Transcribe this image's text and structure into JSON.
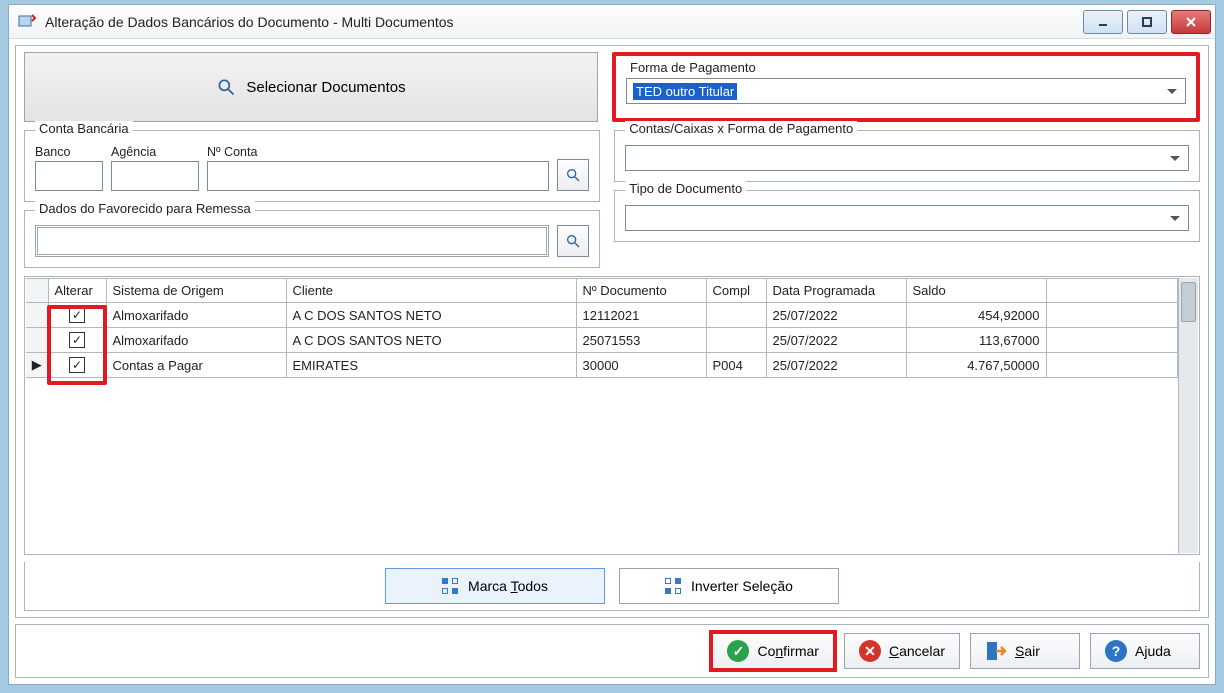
{
  "window": {
    "title": "Alteração de Dados Bancários do Documento - Multi Documentos"
  },
  "buttons": {
    "select_docs": "Selecionar Documentos",
    "marca_todos_pre": "Marca ",
    "marca_todos_key": "T",
    "marca_todos_post": "odos",
    "inverter": "Inverter Seleção",
    "confirmar_pre": "Co",
    "confirmar_key": "n",
    "confirmar_post": "firmar",
    "cancelar_key": "C",
    "cancelar_post": "ancelar",
    "sair_key": "S",
    "sair_post": "air",
    "ajuda": "Ajuda"
  },
  "groups": {
    "forma_pagamento": "Forma de Pagamento",
    "conta_bancaria": "Conta Bancária",
    "banco": "Banco",
    "agencia": "Agência",
    "n_conta": "Nº Conta",
    "favorecido": "Dados do Favorecido para Remessa",
    "contas_caixas": "Contas/Caixas x Forma de Pagamento",
    "tipo_documento": "Tipo de Documento"
  },
  "forma_pagamento_value": "TED outro Titular",
  "contas_caixas_value": "",
  "tipo_documento_value": "",
  "table": {
    "cols": {
      "alterar": "Alterar",
      "sistema": "Sistema de Origem",
      "cliente": "Cliente",
      "ndoc": "Nº Documento",
      "compl": "Compl",
      "data": "Data Programada",
      "saldo": "Saldo"
    },
    "rows": [
      {
        "alterar": true,
        "sistema": "Almoxarifado",
        "cliente": "A C DOS SANTOS NETO",
        "ndoc": "12112021",
        "compl": "",
        "data": "25/07/2022",
        "saldo": "454,92000",
        "current": false
      },
      {
        "alterar": true,
        "sistema": "Almoxarifado",
        "cliente": "A C DOS SANTOS NETO",
        "ndoc": "25071553",
        "compl": "",
        "data": "25/07/2022",
        "saldo": "113,67000",
        "current": false
      },
      {
        "alterar": true,
        "sistema": "Contas a Pagar",
        "cliente": "EMIRATES",
        "ndoc": "30000",
        "compl": "P004",
        "data": "25/07/2022",
        "saldo": "4.767,50000",
        "current": true
      }
    ]
  }
}
